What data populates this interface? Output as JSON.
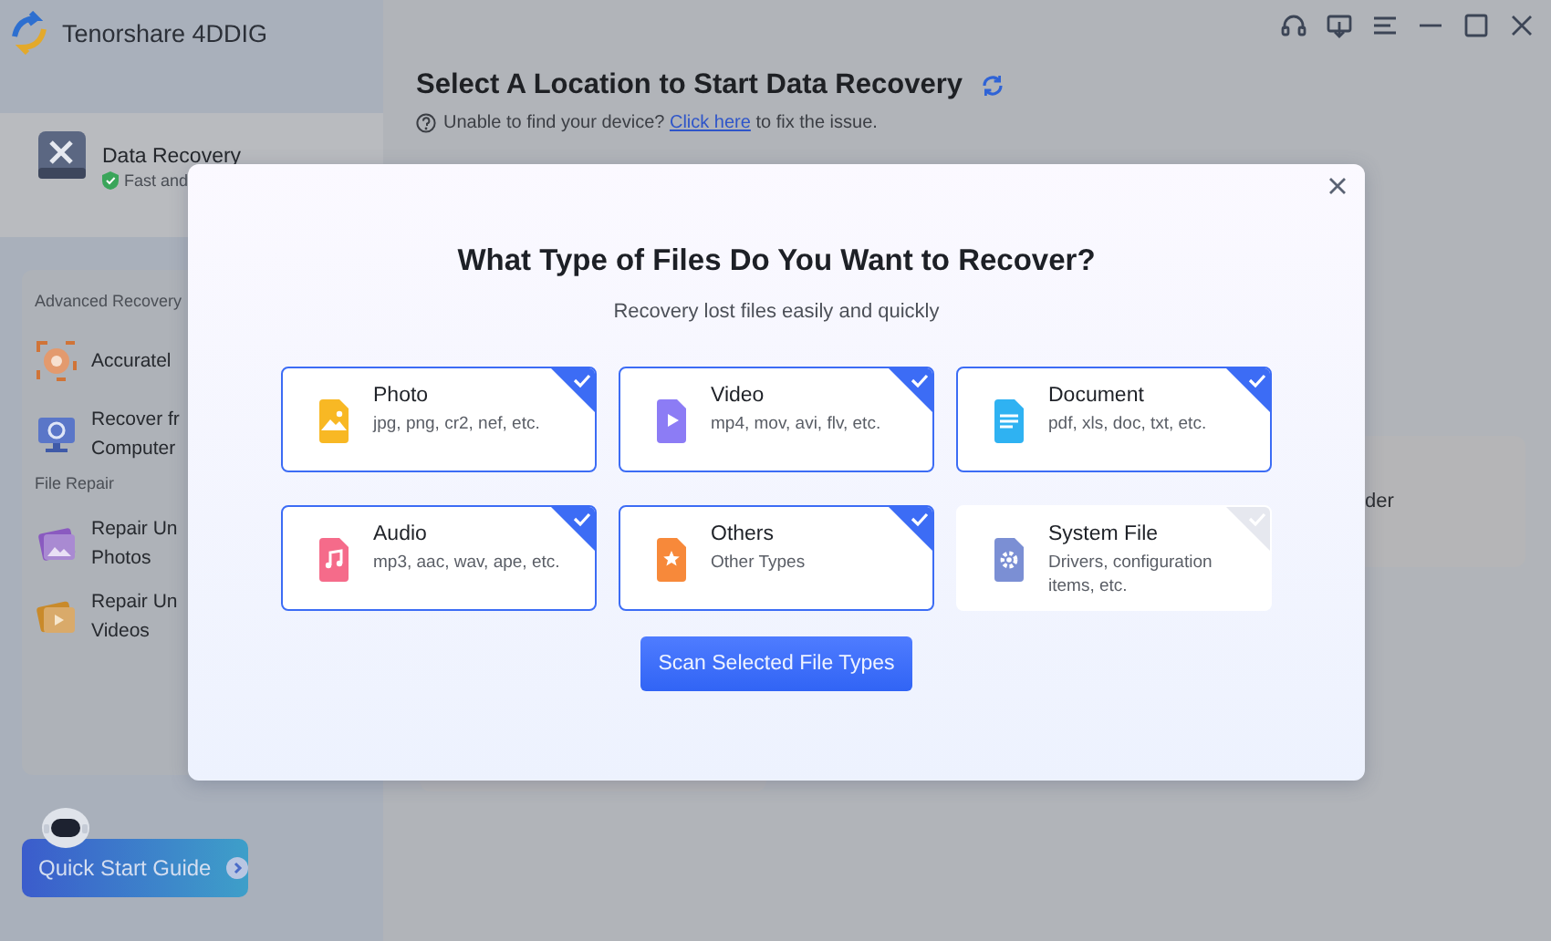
{
  "app": {
    "name": "Tenorshare 4DDIG"
  },
  "sidebar": {
    "main_item": {
      "title": "Data Recovery",
      "subtitle": "Fast and",
      "selected": true
    },
    "sections": [
      {
        "heading": "Advanced Recovery",
        "items": [
          {
            "kind": "target",
            "lines": [
              "Accuratel"
            ]
          },
          {
            "kind": "computer",
            "lines": [
              "Recover fr",
              "Computer"
            ]
          }
        ]
      },
      {
        "heading": "File Repair",
        "items": [
          {
            "kind": "photos",
            "lines": [
              "Repair Un",
              "Photos"
            ]
          },
          {
            "kind": "videos",
            "lines": [
              "Repair Un",
              "Videos"
            ]
          }
        ]
      }
    ],
    "quick_start": "Quick Start Guide"
  },
  "main": {
    "title": "Select A Location to Start Data Recovery",
    "hint_before": "Unable to find your device?",
    "hint_link": "Click here",
    "hint_after": "to fix the issue.",
    "side_card": "der"
  },
  "dialog": {
    "title": "What Type of Files Do You Want to Recover?",
    "subtitle": "Recovery lost files easily and quickly",
    "types": [
      {
        "kind": "photo",
        "name": "Photo",
        "formats": "jpg, png, cr2, nef, etc.",
        "selected": true
      },
      {
        "kind": "video",
        "name": "Video",
        "formats": "mp4, mov, avi, flv, etc.",
        "selected": true
      },
      {
        "kind": "document",
        "name": "Document",
        "formats": "pdf, xls, doc, txt, etc.",
        "selected": true
      },
      {
        "kind": "audio",
        "name": "Audio",
        "formats": "mp3, aac, wav, ape, etc.",
        "selected": true
      },
      {
        "kind": "others",
        "name": "Others",
        "formats": "Other Types",
        "selected": true
      },
      {
        "kind": "system",
        "name": "System File",
        "formats": "Drivers, configuration items, etc.",
        "selected": false
      }
    ],
    "scan_button": "Scan Selected File Types"
  }
}
